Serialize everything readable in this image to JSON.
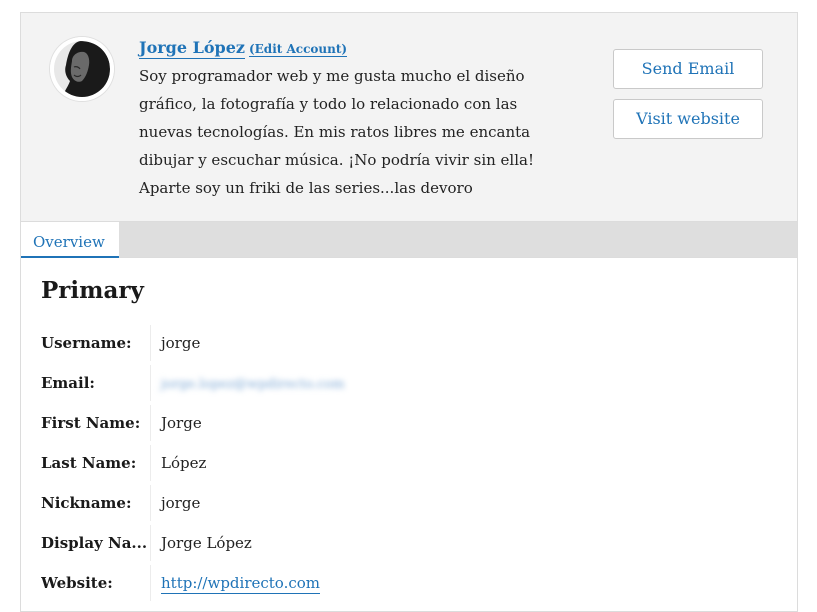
{
  "profile": {
    "name": "Jorge López",
    "edit_label": "(Edit Account)",
    "bio": "Soy programador web y me gusta mucho el diseño gráfico, la fotografía y todo lo relacionado con las nuevas tecnologías. En mis ratos libres me encanta dibujar y escuchar música. ¡No podría vivir sin ella! Aparte soy un friki de las series...las devoro",
    "avatar_icon": "user-avatar-photo"
  },
  "actions": {
    "send_email": "Send Email",
    "visit_website": "Visit website"
  },
  "tabs": [
    {
      "label": "Overview",
      "active": true
    }
  ],
  "section": {
    "title": "Primary"
  },
  "fields": {
    "username": {
      "label": "Username:",
      "value": "jorge"
    },
    "email": {
      "label": "Email:",
      "value": "jorge.lopez@wpdirecto.com"
    },
    "first_name": {
      "label": "First Name:",
      "value": "Jorge"
    },
    "last_name": {
      "label": "Last Name:",
      "value": "López"
    },
    "nickname": {
      "label": "Nickname:",
      "value": "jorge"
    },
    "display_name": {
      "label": "Display Na...",
      "value": "Jorge López"
    },
    "website": {
      "label": "Website:",
      "value": "http://wpdirecto.com"
    }
  },
  "colors": {
    "accent": "#1f73b7",
    "header_bg": "#f3f3f3",
    "tabbar_bg": "#dedede"
  }
}
